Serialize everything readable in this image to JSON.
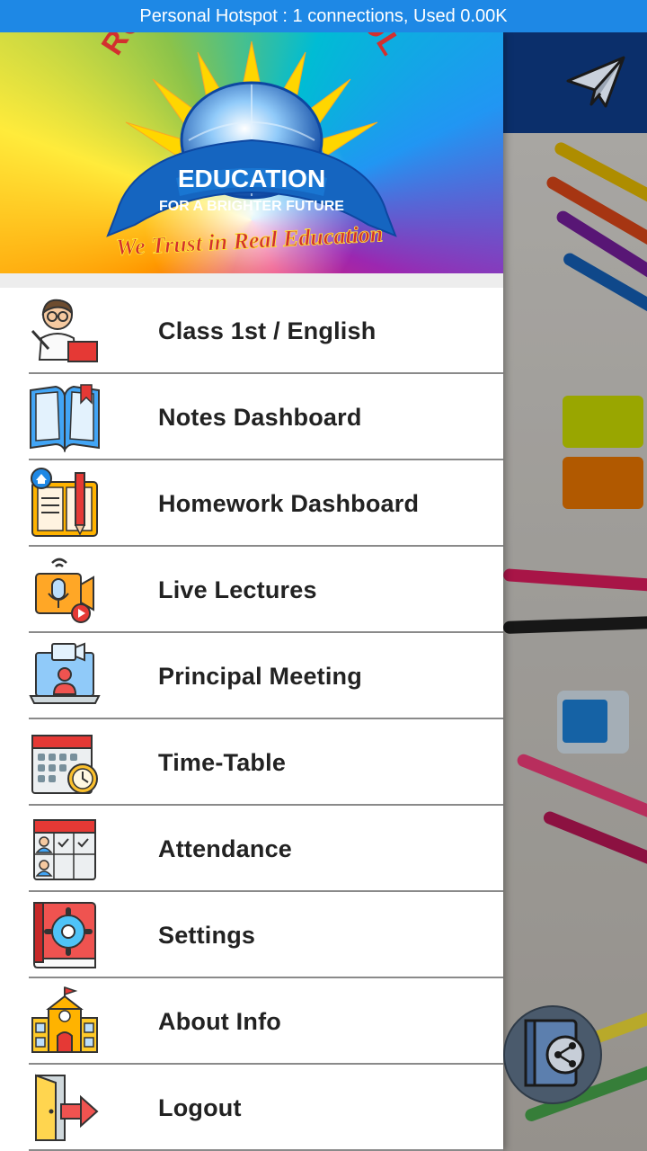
{
  "status_bar": {
    "text": "Personal Hotspot : 1 connections, Used 0.00K"
  },
  "drawer": {
    "logo": {
      "arc_text": "RCL WORLD SCHOOL",
      "banner_top": "EDUCATION",
      "banner_bottom": "FOR A BRIGHTER FUTURE",
      "tagline": "We Trust in Real Education"
    },
    "menu": [
      {
        "label": "Class 1st / English",
        "icon": "teacher-icon"
      },
      {
        "label": "Notes Dashboard",
        "icon": "open-book-icon"
      },
      {
        "label": "Homework Dashboard",
        "icon": "homework-book-icon"
      },
      {
        "label": "Live Lectures",
        "icon": "live-video-icon"
      },
      {
        "label": "Principal Meeting",
        "icon": "video-meeting-icon"
      },
      {
        "label": "Time-Table",
        "icon": "calendar-clock-icon"
      },
      {
        "label": "Attendance",
        "icon": "attendance-calendar-icon"
      },
      {
        "label": "Settings",
        "icon": "settings-book-icon"
      },
      {
        "label": "About Info",
        "icon": "school-building-icon"
      },
      {
        "label": "Logout",
        "icon": "logout-door-icon"
      }
    ]
  },
  "header": {
    "action_icon": "paper-plane-icon"
  },
  "fab": {
    "icon": "share-book-icon"
  },
  "colors": {
    "status_bar": "#1e88e5",
    "app_bar": "#0b2f6b",
    "menu_text": "#222222",
    "divider": "#8a8a8a"
  }
}
